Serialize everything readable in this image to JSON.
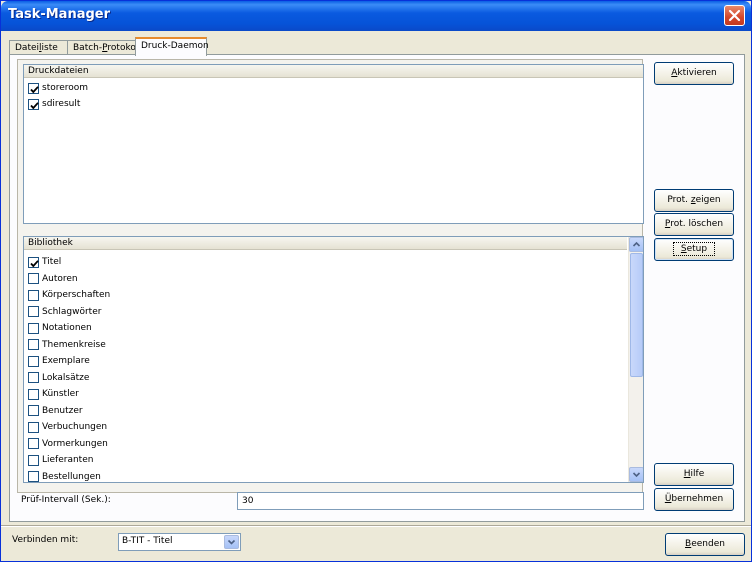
{
  "window": {
    "title": "Task-Manager"
  },
  "tabs": [
    {
      "label": "Dateiliste",
      "pre": "Datei",
      "key": "l",
      "post": "iste"
    },
    {
      "label": "Batch-Protokoll",
      "pre": "Batch-",
      "key": "P",
      "post": "rotokoll"
    },
    {
      "label": "Druck-Daemon",
      "pre": "Druck-Daemon",
      "key": "",
      "post": ""
    }
  ],
  "druckdateien": {
    "header": "Druckdateien",
    "items": [
      {
        "label": "storeroom",
        "checked": true
      },
      {
        "label": "sdiresult",
        "checked": true
      }
    ]
  },
  "bibliothek": {
    "header": "Bibliothek",
    "items": [
      {
        "label": "Titel",
        "checked": true
      },
      {
        "label": "Autoren",
        "checked": false
      },
      {
        "label": "Körperschaften",
        "checked": false
      },
      {
        "label": "Schlagwörter",
        "checked": false
      },
      {
        "label": "Notationen",
        "checked": false
      },
      {
        "label": "Themenkreise",
        "checked": false
      },
      {
        "label": "Exemplare",
        "checked": false
      },
      {
        "label": "Lokalsätze",
        "checked": false
      },
      {
        "label": "Künstler",
        "checked": false
      },
      {
        "label": "Benutzer",
        "checked": false
      },
      {
        "label": "Verbuchungen",
        "checked": false
      },
      {
        "label": "Vormerkungen",
        "checked": false
      },
      {
        "label": "Lieferanten",
        "checked": false
      },
      {
        "label": "Bestellungen",
        "checked": false
      }
    ]
  },
  "pruef": {
    "label": "Prüf-Intervall (Sek.):",
    "value": "30"
  },
  "buttons": {
    "aktivieren": {
      "pre": "",
      "key": "A",
      "post": "ktivieren"
    },
    "prot_zeigen": {
      "pre": "Prot. ",
      "key": "z",
      "post": "eigen"
    },
    "prot_loeschen": {
      "pre": "",
      "key": "P",
      "post": "rot. löschen"
    },
    "setup": {
      "pre": "",
      "key": "S",
      "post": "etup"
    },
    "hilfe": {
      "pre": "",
      "key": "H",
      "post": "ilfe"
    },
    "uebernehmen": {
      "pre": "",
      "key": "Ü",
      "post": "bernehmen"
    },
    "beenden": {
      "pre": "",
      "key": "B",
      "post": "eenden"
    }
  },
  "verbinden": {
    "label": "Verbinden mit:",
    "selected": "B-TIT - Titel"
  }
}
